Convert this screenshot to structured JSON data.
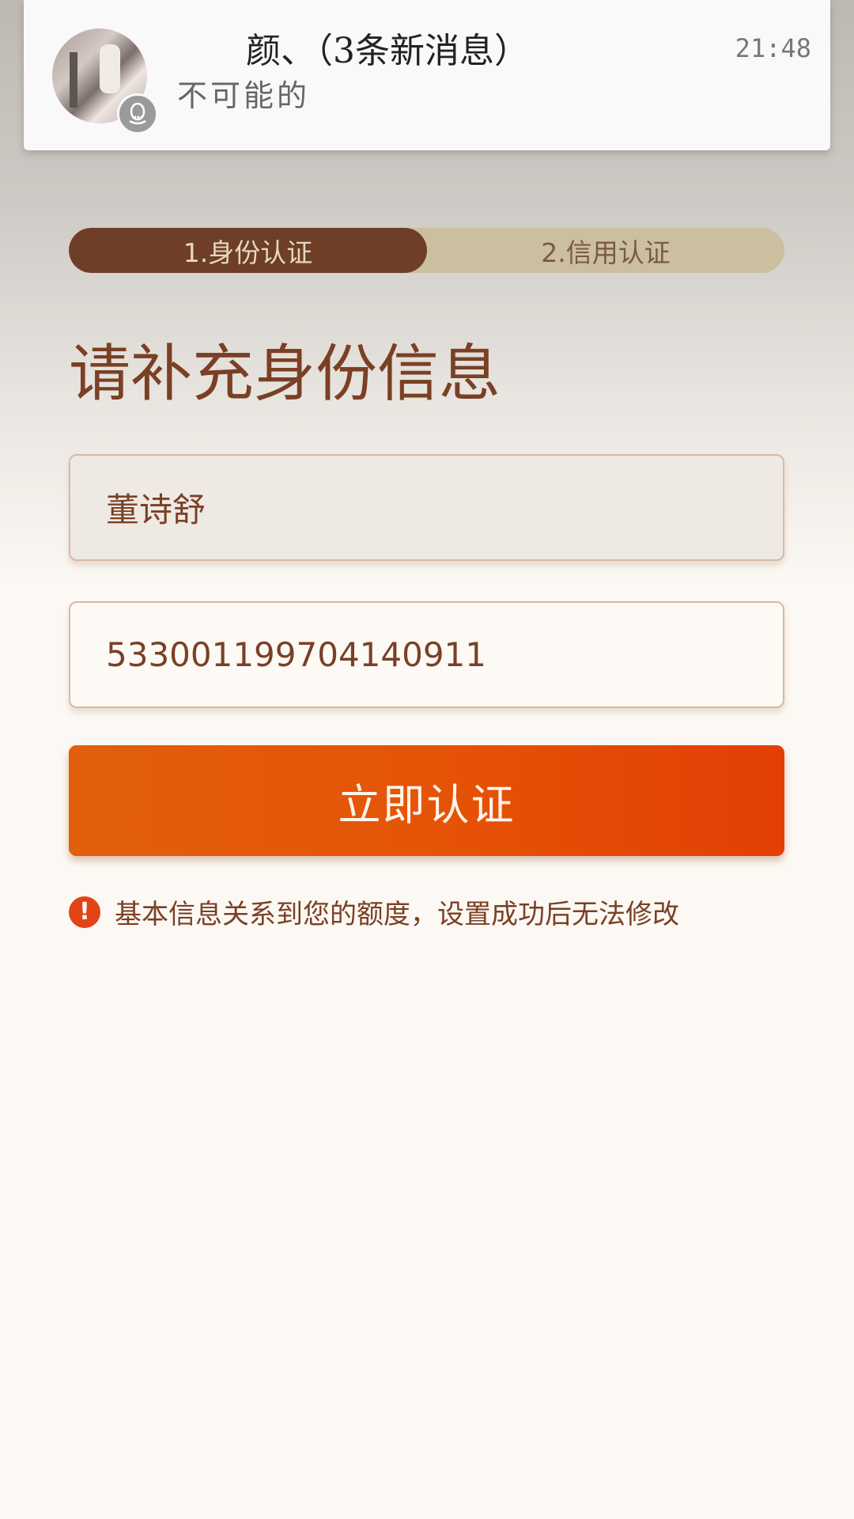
{
  "notification": {
    "title": "颜、（3条新消息）",
    "body": "不可能的",
    "time": "21:48",
    "avatar_icon": "user-avatar",
    "badge_icon": "qq-penguin-icon"
  },
  "steps": [
    {
      "label": "1.身份认证",
      "active": true
    },
    {
      "label": "2.信用认证",
      "active": false
    }
  ],
  "page_title": "请补充身份信息",
  "form": {
    "name_value": "董诗舒",
    "id_number_value": "533001199704140911"
  },
  "submit_label": "立即认证",
  "notice": {
    "icon": "exclamation-icon",
    "icon_glyph": "!",
    "text": "基本信息关系到您的额度，设置成功后无法修改"
  },
  "colors": {
    "accent_orange": "#e55407",
    "step_active_bg": "#6e3e27",
    "step_inactive_bg": "#ccbfa0",
    "text_brown": "#7a4025"
  }
}
